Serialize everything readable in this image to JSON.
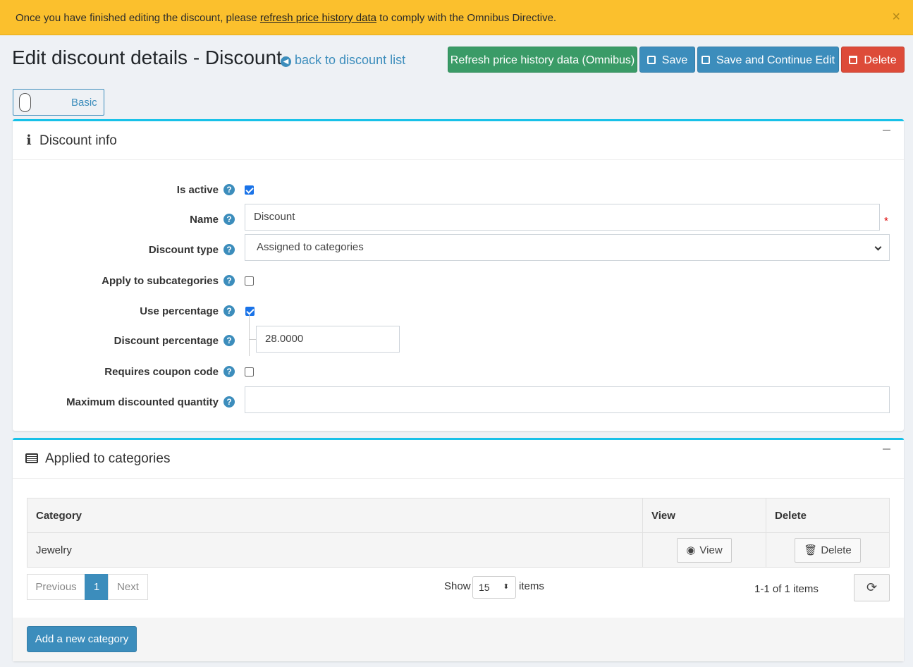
{
  "alert": {
    "text_before": "Once you have finished editing the discount, please ",
    "link": "refresh price history data",
    "text_after": " to comply with the Omnibus Directive.",
    "close": "×"
  },
  "header": {
    "title": "Edit discount details - Discount",
    "back_link": "back to discount list",
    "buttons": {
      "refresh": "Refresh price history data (Omnibus)",
      "save": "Save",
      "save_continue": "Save and Continue Edit",
      "delete": "Delete"
    }
  },
  "mode_toggle": {
    "label": "Basic"
  },
  "discount_info": {
    "title": "Discount info",
    "fields": {
      "is_active": {
        "label": "Is active",
        "checked": true
      },
      "name": {
        "label": "Name",
        "value": "Discount",
        "required": "*"
      },
      "discount_type": {
        "label": "Discount type",
        "value": "Assigned to categories"
      },
      "apply_subcategories": {
        "label": "Apply to subcategories",
        "checked": false
      },
      "use_percentage": {
        "label": "Use percentage",
        "checked": true
      },
      "discount_percentage": {
        "label": "Discount percentage",
        "value": "28.0000"
      },
      "requires_coupon": {
        "label": "Requires coupon code",
        "checked": false
      },
      "max_quantity": {
        "label": "Maximum discounted quantity",
        "value": ""
      }
    }
  },
  "applied_categories": {
    "title": "Applied to categories",
    "columns": [
      "Category",
      "View",
      "Delete"
    ],
    "rows": [
      {
        "category": "Jewelry",
        "view": "View",
        "delete": "Delete"
      }
    ],
    "pagination": {
      "previous": "Previous",
      "page": "1",
      "next": "Next",
      "show": "Show",
      "page_size": "15",
      "items": "items",
      "summary": "1-1 of 1 items"
    },
    "add_button": "Add a new category"
  },
  "colors": {
    "alert": "#fbc02d",
    "primary": "#3c8dbc",
    "success": "#3a9b67",
    "danger": "#dd4b39",
    "card_accent": "#17c1e8"
  }
}
